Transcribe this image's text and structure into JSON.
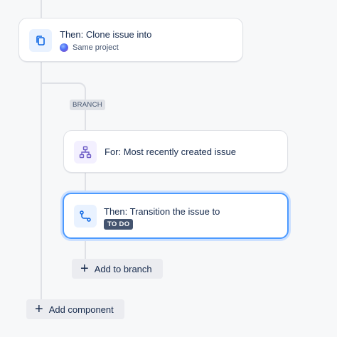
{
  "clone_card": {
    "title": "Then: Clone issue into",
    "subtitle": "Same project",
    "icon": "copy-icon"
  },
  "branch": {
    "label": "BRANCH"
  },
  "for_card": {
    "title": "For: Most recently created issue",
    "icon": "hierarchy-icon"
  },
  "transition_card": {
    "title": "Then: Transition the issue to",
    "status": "TO DO",
    "icon": "transition-icon"
  },
  "buttons": {
    "add_to_branch": "Add to branch",
    "add_component": "Add component"
  },
  "colors": {
    "accent": "#4c9aff",
    "icon_blue": "#0c66e4",
    "icon_purple": "#6e5dc6"
  }
}
